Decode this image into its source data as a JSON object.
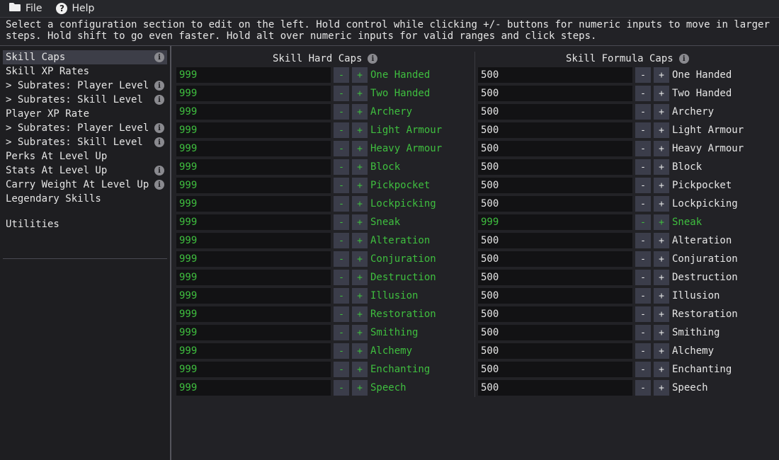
{
  "menu": {
    "file_label": "File",
    "help_label": "Help",
    "file_icon": "folder-icon",
    "help_icon": "help-circle-icon",
    "help_glyph": "?"
  },
  "help_text": "Select a configuration section to edit on the left. Hold control while clicking +/- buttons for numeric inputs to move in larger\nsteps. Hold shift to go even faster. Hold alt over numeric inputs for valid ranges and click steps.",
  "sidebar": {
    "items": [
      {
        "label": "Skill Caps",
        "info": true,
        "selected": true
      },
      {
        "label": "Skill XP Rates",
        "info": false
      },
      {
        "label": "> Subrates: Player Level",
        "info": true
      },
      {
        "label": "> Subrates: Skill Level",
        "info": true
      },
      {
        "label": "Player XP Rate",
        "info": false
      },
      {
        "label": "> Subrates: Player Level",
        "info": true
      },
      {
        "label": "> Subrates: Skill Level",
        "info": true
      },
      {
        "label": "Perks At Level Up",
        "info": false
      },
      {
        "label": "Stats At Level Up",
        "info": true
      },
      {
        "label": "Carry Weight At Level Up",
        "info": true
      },
      {
        "label": "Legendary Skills",
        "info": false
      }
    ],
    "utilities_label": "Utilities"
  },
  "info_glyph": "i",
  "buttons": {
    "minus": "-",
    "plus": "+"
  },
  "hard_caps": {
    "header": "Skill Hard Caps",
    "rows": [
      {
        "value": "999",
        "name": "One Handed",
        "modified": true
      },
      {
        "value": "999",
        "name": "Two Handed",
        "modified": true
      },
      {
        "value": "999",
        "name": "Archery",
        "modified": true
      },
      {
        "value": "999",
        "name": "Light Armour",
        "modified": true
      },
      {
        "value": "999",
        "name": "Heavy Armour",
        "modified": true
      },
      {
        "value": "999",
        "name": "Block",
        "modified": true
      },
      {
        "value": "999",
        "name": "Pickpocket",
        "modified": true
      },
      {
        "value": "999",
        "name": "Lockpicking",
        "modified": true
      },
      {
        "value": "999",
        "name": "Sneak",
        "modified": true
      },
      {
        "value": "999",
        "name": "Alteration",
        "modified": true
      },
      {
        "value": "999",
        "name": "Conjuration",
        "modified": true
      },
      {
        "value": "999",
        "name": "Destruction",
        "modified": true
      },
      {
        "value": "999",
        "name": "Illusion",
        "modified": true
      },
      {
        "value": "999",
        "name": "Restoration",
        "modified": true
      },
      {
        "value": "999",
        "name": "Smithing",
        "modified": true
      },
      {
        "value": "999",
        "name": "Alchemy",
        "modified": true
      },
      {
        "value": "999",
        "name": "Enchanting",
        "modified": true
      },
      {
        "value": "999",
        "name": "Speech",
        "modified": true
      }
    ]
  },
  "formula_caps": {
    "header": "Skill Formula Caps",
    "rows": [
      {
        "value": "500",
        "name": "One Handed",
        "modified": false
      },
      {
        "value": "500",
        "name": "Two Handed",
        "modified": false
      },
      {
        "value": "500",
        "name": "Archery",
        "modified": false
      },
      {
        "value": "500",
        "name": "Light Armour",
        "modified": false
      },
      {
        "value": "500",
        "name": "Heavy Armour",
        "modified": false
      },
      {
        "value": "500",
        "name": "Block",
        "modified": false
      },
      {
        "value": "500",
        "name": "Pickpocket",
        "modified": false
      },
      {
        "value": "500",
        "name": "Lockpicking",
        "modified": false
      },
      {
        "value": "999",
        "name": "Sneak",
        "modified": true
      },
      {
        "value": "500",
        "name": "Alteration",
        "modified": false
      },
      {
        "value": "500",
        "name": "Conjuration",
        "modified": false
      },
      {
        "value": "500",
        "name": "Destruction",
        "modified": false
      },
      {
        "value": "500",
        "name": "Illusion",
        "modified": false
      },
      {
        "value": "500",
        "name": "Restoration",
        "modified": false
      },
      {
        "value": "500",
        "name": "Smithing",
        "modified": false
      },
      {
        "value": "500",
        "name": "Alchemy",
        "modified": false
      },
      {
        "value": "500",
        "name": "Enchanting",
        "modified": false
      },
      {
        "value": "500",
        "name": "Speech",
        "modified": false
      }
    ]
  },
  "colors": {
    "modified": "#3fbf3f",
    "default": "#e6e6e6",
    "accent_selected": "#3d3e48"
  }
}
